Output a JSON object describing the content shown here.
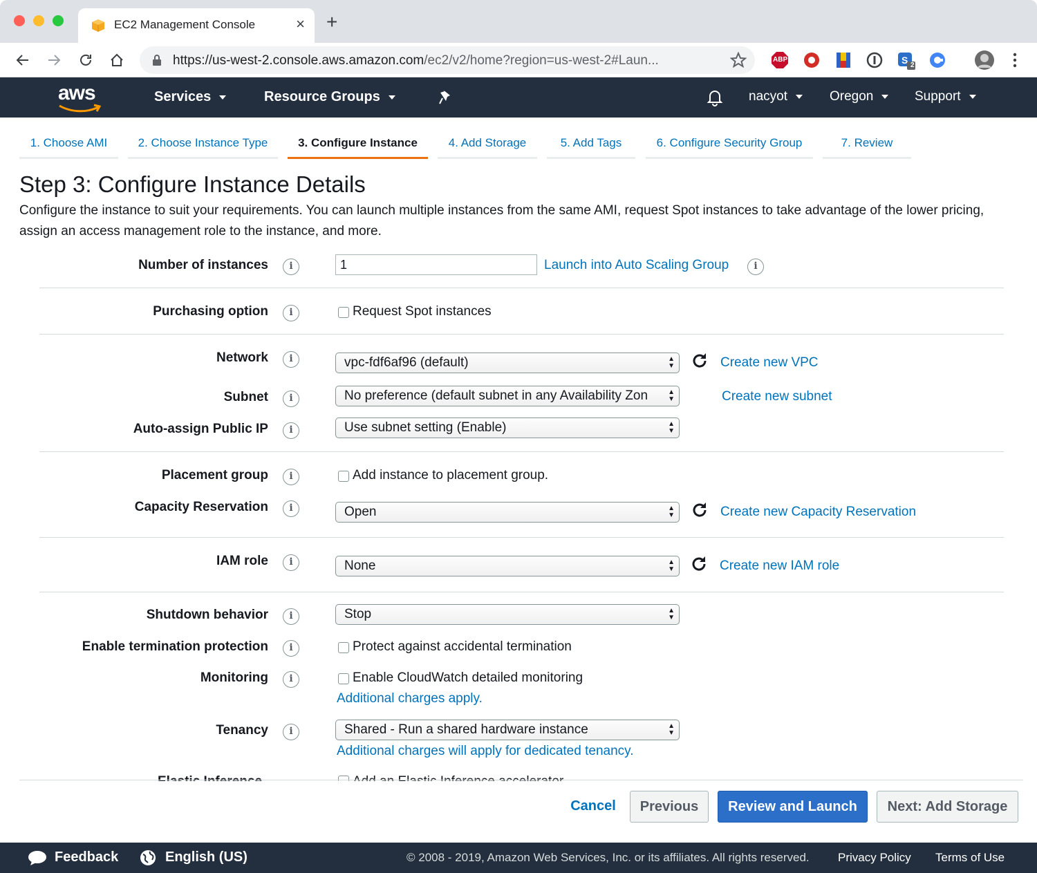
{
  "browser": {
    "tab_title": "EC2 Management Console",
    "url_host": "https://us-west-2.console.aws.amazon.com",
    "url_path": "/ec2/v2/home?region=us-west-2#Laun...",
    "extension_badge": "2",
    "abp_label": "ABP"
  },
  "header": {
    "logo": "aws",
    "services": "Services",
    "resource_groups": "Resource Groups",
    "user": "nacyot",
    "region": "Oregon",
    "support": "Support"
  },
  "steps": [
    {
      "label": "1. Choose AMI"
    },
    {
      "label": "2. Choose Instance Type"
    },
    {
      "label": "3. Configure Instance"
    },
    {
      "label": "4. Add Storage"
    },
    {
      "label": "5. Add Tags"
    },
    {
      "label": "6. Configure Security Group"
    },
    {
      "label": "7. Review"
    }
  ],
  "page": {
    "title": "Step 3: Configure Instance Details",
    "description": "Configure the instance to suit your requirements. You can launch multiple instances from the same AMI, request Spot instances to take advantage of the lower pricing, assign an access management role to the instance, and more."
  },
  "form": {
    "instances": {
      "label": "Number of instances",
      "value": "1",
      "link": "Launch into Auto Scaling Group"
    },
    "purchasing": {
      "label": "Purchasing option",
      "checkbox": "Request Spot instances"
    },
    "network": {
      "label": "Network",
      "value": "vpc-fdf6af96 (default)",
      "link": "Create new VPC"
    },
    "subnet": {
      "label": "Subnet",
      "value": "No preference (default subnet in any Availability Zon",
      "link": "Create new subnet"
    },
    "public_ip": {
      "label": "Auto-assign Public IP",
      "value": "Use subnet setting (Enable)"
    },
    "placement": {
      "label": "Placement group",
      "checkbox": "Add instance to placement group."
    },
    "capacity": {
      "label": "Capacity Reservation",
      "value": "Open",
      "link": "Create new Capacity Reservation"
    },
    "iam": {
      "label": "IAM role",
      "value": "None",
      "link": "Create new IAM role"
    },
    "shutdown": {
      "label": "Shutdown behavior",
      "value": "Stop"
    },
    "termination": {
      "label": "Enable termination protection",
      "checkbox": "Protect against accidental termination"
    },
    "monitoring": {
      "label": "Monitoring",
      "checkbox": "Enable CloudWatch detailed monitoring",
      "note": "Additional charges apply."
    },
    "tenancy": {
      "label": "Tenancy",
      "value": "Shared - Run a shared hardware instance",
      "note": "Additional charges will apply for dedicated tenancy."
    },
    "elastic": {
      "label": "Elastic Inference",
      "checkbox": "Add an Elastic Inference accelerator"
    }
  },
  "actions": {
    "cancel": "Cancel",
    "previous": "Previous",
    "review": "Review and Launch",
    "next": "Next: Add Storage"
  },
  "footer": {
    "feedback": "Feedback",
    "language": "English (US)",
    "copyright": "© 2008 - 2019, Amazon Web Services, Inc. or its affiliates. All rights reserved.",
    "privacy": "Privacy Policy",
    "terms": "Terms of Use"
  },
  "colors": {
    "aws_navy": "#232f3e",
    "link_blue": "#0073bb",
    "primary_button": "#2b6fc9",
    "active_step_accent": "#ec7211"
  }
}
